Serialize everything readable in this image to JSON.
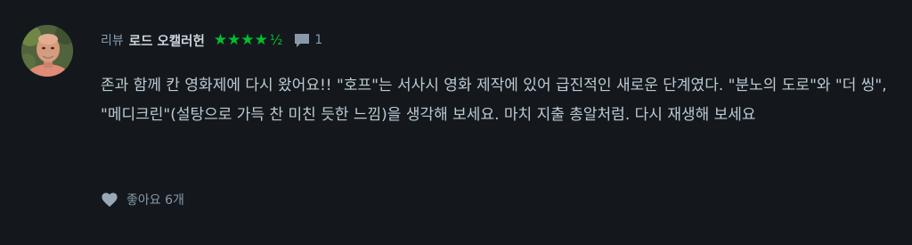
{
  "review": {
    "label": "리뷰",
    "author": "로드 오캘러헌",
    "stars": "★★★★",
    "half_star": "½",
    "rating": 4.5,
    "comment_count": "1",
    "body": "존과 함께 칸 영화제에 다시 왔어요!! \"호프\"는 서사시 영화 제작에 있어 급진적인 새로운 단계였다. \"분노의 도로\"와 \"더 씽\", \"메디크린\"(설탕으로 가득 찬 미친 듯한 느낌)을 생각해 보세요. 마치 지출 총알처럼. 다시 재생해 보세요",
    "likes_label": "좋아요 6개"
  },
  "colors": {
    "background": "#14181c",
    "star": "#00c030",
    "muted_text": "#8899aa",
    "body_text": "#bccad6"
  },
  "icons": {
    "comment": "comment-icon",
    "heart": "heart-icon"
  }
}
